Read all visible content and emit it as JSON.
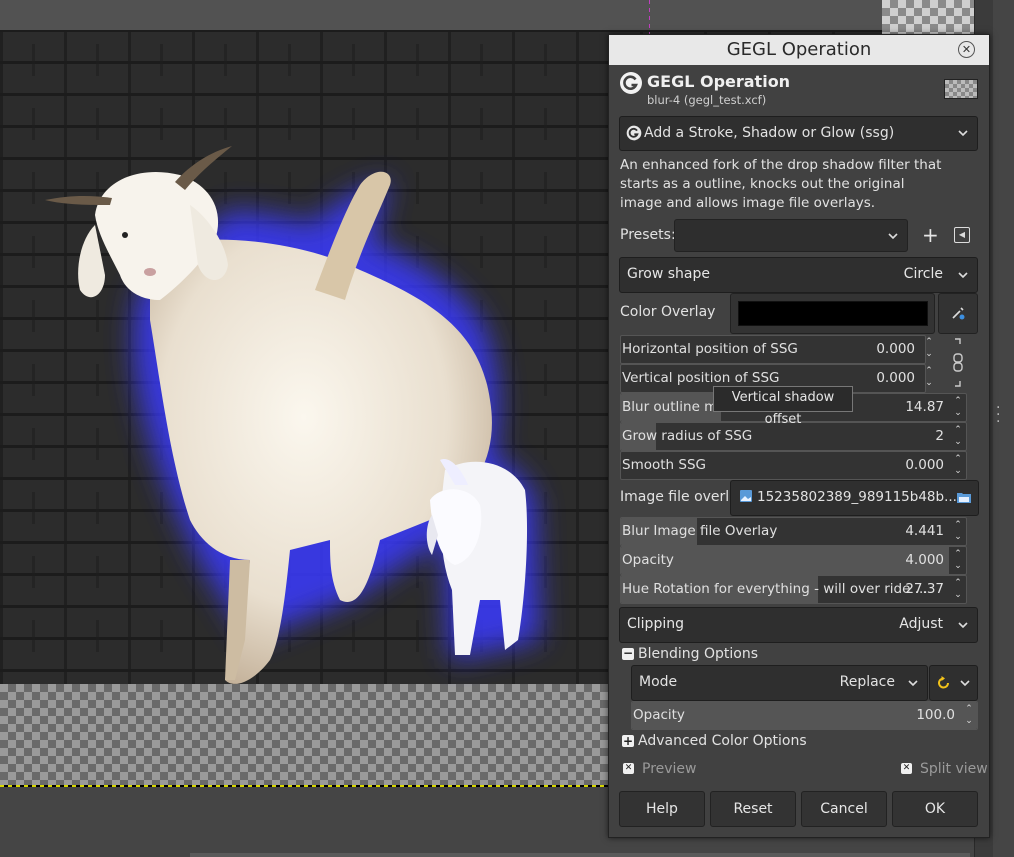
{
  "dialog": {
    "window_title": "GEGL Operation",
    "header_title": "GEGL Operation",
    "header_subtitle": "blur-4 (gegl_test.xcf)",
    "operation_label": "Add a Stroke, Shadow or Glow (ssg)",
    "description": [
      "An enhanced fork of the drop shadow filter that",
      "starts as a outline, knocks out the original",
      "image and allows image file overlays."
    ],
    "presets_label": "Presets:",
    "presets_value": "",
    "grow_shape": {
      "label": "Grow shape",
      "value": "Circle"
    },
    "color_overlay": {
      "label": "Color Overlay",
      "color": "#000000"
    },
    "spins": [
      {
        "label": "Horizontal position of SSG",
        "value": "0.000",
        "fill": 0.5
      },
      {
        "label": "Vertical position of SSG",
        "value": "0.000",
        "fill": 0.5
      },
      {
        "label": "Blur outline mo",
        "value": "14.87",
        "fill": 0.29
      },
      {
        "label": "Grow radius of SSG",
        "value": "2",
        "fill": 0.1
      },
      {
        "label": "Smooth SSG",
        "value": "0.000",
        "fill": 0.0
      },
      {
        "label": "Blur Image file Overlay",
        "value": "4.441",
        "fill": 0.22
      },
      {
        "label": "Opacity",
        "value": "4.000",
        "fill": 1.0
      },
      {
        "label": "Hue Rotation for everything - will over ride ...",
        "value": "27.37",
        "fill": 0.58
      }
    ],
    "image_overlay": {
      "label": "Image file overlay",
      "value": "15235802389_989115b48b..."
    },
    "clipping": {
      "label": "Clipping",
      "value": "Adjust"
    },
    "blending_options_label": "Blending Options",
    "mode": {
      "label": "Mode",
      "value": "Replace"
    },
    "blend_opacity": {
      "label": "Opacity",
      "value": "100.0"
    },
    "advanced_color_label": "Advanced Color Options",
    "preview_label": "Preview",
    "split_view_label": "Split view",
    "buttons": {
      "help": "Help",
      "reset": "Reset",
      "cancel": "Cancel",
      "ok": "OK"
    },
    "tooltip": "Vertical shadow offset"
  },
  "colors": {
    "glow": "#3a3aff",
    "dialog_bg": "#414141",
    "title_bg": "#e8e8e8"
  }
}
